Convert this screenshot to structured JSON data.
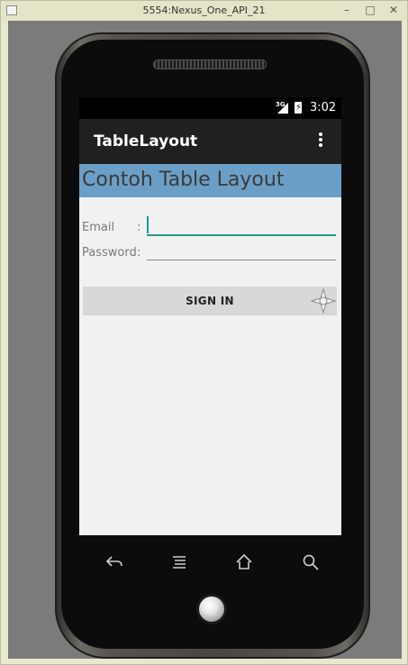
{
  "window": {
    "title": "5554:Nexus_One_API_21",
    "minimize_glyph": "–",
    "maximize_glyph": "□",
    "close_glyph": "✕"
  },
  "statusbar": {
    "network": "3G",
    "time": "3:02"
  },
  "actionbar": {
    "title": "TableLayout",
    "overflow_icon": "more-vert-icon"
  },
  "header": {
    "text": "Contoh Table Layout",
    "background": "#6c9fc7"
  },
  "form": {
    "email": {
      "label": "Email",
      "colon": ":",
      "value": ""
    },
    "password": {
      "label": "Password",
      "colon": ":",
      "value": ""
    },
    "accent_color": "#1f9a8c"
  },
  "signin": {
    "label": "SIGN IN"
  },
  "navbar": {
    "icons": [
      "back-icon",
      "menu-icon",
      "home-icon",
      "search-icon"
    ]
  }
}
